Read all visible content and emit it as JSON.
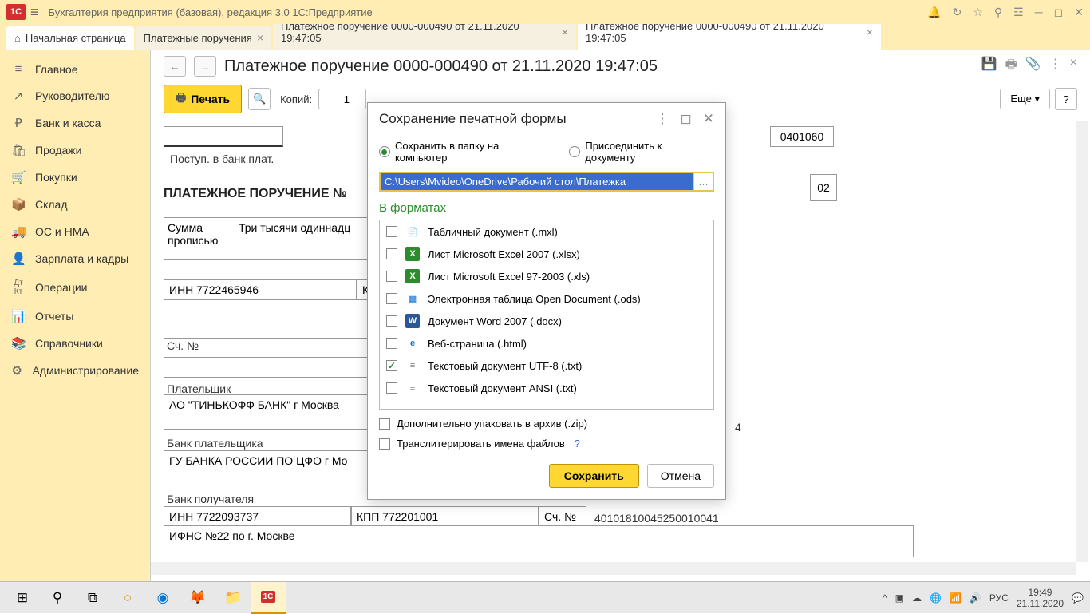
{
  "titlebar": {
    "text": "Бухгалтерия предприятия (базовая), редакция 3.0  1С:Предприятие"
  },
  "tabs": [
    {
      "label": "Начальная страница",
      "home": true
    },
    {
      "label": "Платежные поручения",
      "closable": true
    },
    {
      "label": "Платежное поручение 0000-000490 от 21.11.2020 19:47:05",
      "closable": true
    },
    {
      "label": "Платежное поручение 0000-000490 от 21.11.2020 19:47:05",
      "closable": true
    }
  ],
  "sidebar": {
    "items": [
      {
        "icon": "≡",
        "label": "Главное"
      },
      {
        "icon": "↗",
        "label": "Руководителю"
      },
      {
        "icon": "₽",
        "label": "Банк и касса"
      },
      {
        "icon": "🛍",
        "label": "Продажи"
      },
      {
        "icon": "🛒",
        "label": "Покупки"
      },
      {
        "icon": "📦",
        "label": "Склад"
      },
      {
        "icon": "🚚",
        "label": "ОС и НМА"
      },
      {
        "icon": "👤",
        "label": "Зарплата и кадры"
      },
      {
        "icon": "Дт",
        "label": "Операции"
      },
      {
        "icon": "📊",
        "label": "Отчеты"
      },
      {
        "icon": "📚",
        "label": "Справочники"
      },
      {
        "icon": "⚙",
        "label": "Администрирование"
      }
    ]
  },
  "document": {
    "title": "Платежное поручение 0000-000490 от 21.11.2020 19:47:05",
    "print_label": "Печать",
    "copies_label": "Копий:",
    "copies_value": "1",
    "more_label": "Еще",
    "code": "0401060",
    "postup": "Поступ. в банк плат.",
    "heading": "ПЛАТЕЖНОЕ ПОРУЧЕНИЕ №",
    "page_num": "02",
    "sum_label": "Сумма прописью",
    "sum_text": "Три тысячи одиннадц",
    "inn1": "ИНН 7722465946",
    "kpp_char": "К",
    "sch_label": "Сч. №",
    "payer_label": "Плательщик",
    "bank1": "АО \"ТИНЬКОФФ БАНК\" г Москва",
    "bank_payer": "Банк плательщика",
    "bank2": "ГУ БАНКА РОССИИ ПО ЦФО г Мо",
    "bank_recv": "Банк получателя",
    "inn2": "ИНН 7722093737",
    "kpp2": "КПП 772201001",
    "sch2_label": "Сч. №",
    "acc": "40101810045250010041",
    "recipient": "ИФНС №22 по г. Москве",
    "trail_4": "4"
  },
  "dialog": {
    "title": "Сохранение печатной формы",
    "radio1": "Сохранить в папку на компьютер",
    "radio2": "Присоединить к документу",
    "path": "C:\\Users\\Mvideo\\OneDrive\\Рабочий стол\\Платежка",
    "formats_title": "В форматах",
    "formats": [
      {
        "label": "Табличный документ (.mxl)",
        "icon": "📄",
        "color": "#888"
      },
      {
        "label": "Лист Microsoft Excel 2007 (.xlsx)",
        "icon": "X",
        "color": "#2c8c2c"
      },
      {
        "label": "Лист Microsoft Excel 97-2003 (.xls)",
        "icon": "X",
        "color": "#2c8c2c"
      },
      {
        "label": "Электронная таблица Open Document (.ods)",
        "icon": "▦",
        "color": "#4a90d9"
      },
      {
        "label": "Документ Word 2007 (.docx)",
        "icon": "W",
        "color": "#2b5797"
      },
      {
        "label": "Веб-страница (.html)",
        "icon": "e",
        "color": "#0078d7"
      },
      {
        "label": "Текстовый документ UTF-8 (.txt)",
        "icon": "≡",
        "color": "#888",
        "checked": true
      },
      {
        "label": "Текстовый документ ANSI (.txt)",
        "icon": "≡",
        "color": "#888"
      }
    ],
    "zip_label": "Дополнительно упаковать в архив (.zip)",
    "translit_label": "Транслитерировать имена файлов",
    "save_btn": "Сохранить",
    "cancel_btn": "Отмена"
  },
  "taskbar": {
    "time": "19:49",
    "date": "21.11.2020",
    "lang": "РУС"
  }
}
